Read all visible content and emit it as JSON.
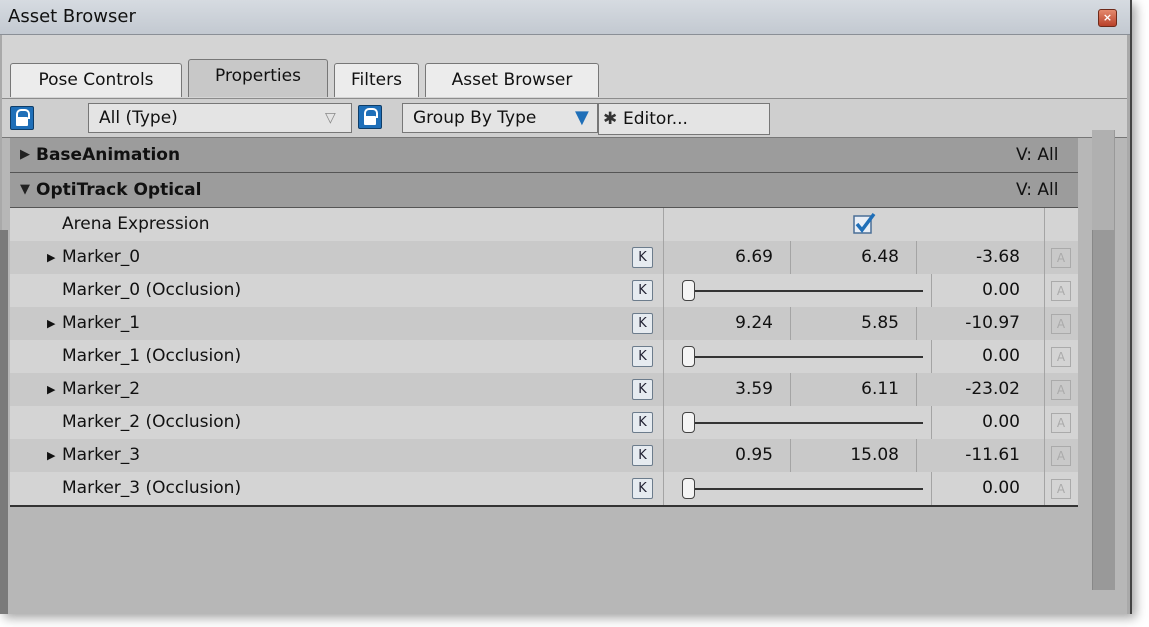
{
  "window": {
    "title": "Asset Browser"
  },
  "tabs": [
    {
      "label": "Pose Controls"
    },
    {
      "label": "Properties"
    },
    {
      "label": "Filters"
    },
    {
      "label": "Asset Browser"
    }
  ],
  "toolbar": {
    "type_filter": "All (Type)",
    "group_by": "Group By Type",
    "editor": "Editor..."
  },
  "groups": {
    "base": {
      "name": "BaseAnimation",
      "visibility": "V: All"
    },
    "opti": {
      "name": "OptiTrack Optical",
      "visibility": "V: All"
    }
  },
  "rows": {
    "arena": {
      "name": "Arena Expression"
    },
    "m0": {
      "name": "Marker_0",
      "x": "6.69",
      "y": "6.48",
      "z": "-3.68"
    },
    "m0o": {
      "name": "Marker_0 (Occlusion)",
      "value": "0.00"
    },
    "m1": {
      "name": "Marker_1",
      "x": "9.24",
      "y": "5.85",
      "z": "-10.97"
    },
    "m1o": {
      "name": "Marker_1 (Occlusion)",
      "value": "0.00"
    },
    "m2": {
      "name": "Marker_2",
      "x": "3.59",
      "y": "6.11",
      "z": "-23.02"
    },
    "m2o": {
      "name": "Marker_2 (Occlusion)",
      "value": "0.00"
    },
    "m3": {
      "name": "Marker_3",
      "x": "0.95",
      "y": "15.08",
      "z": "-11.61"
    },
    "m3o": {
      "name": "Marker_3 (Occlusion)",
      "value": "0.00"
    }
  },
  "labels": {
    "key": "K",
    "anim": "A"
  },
  "colors": {
    "accent": "#1f6fb8",
    "header": "#9c9c9c"
  }
}
